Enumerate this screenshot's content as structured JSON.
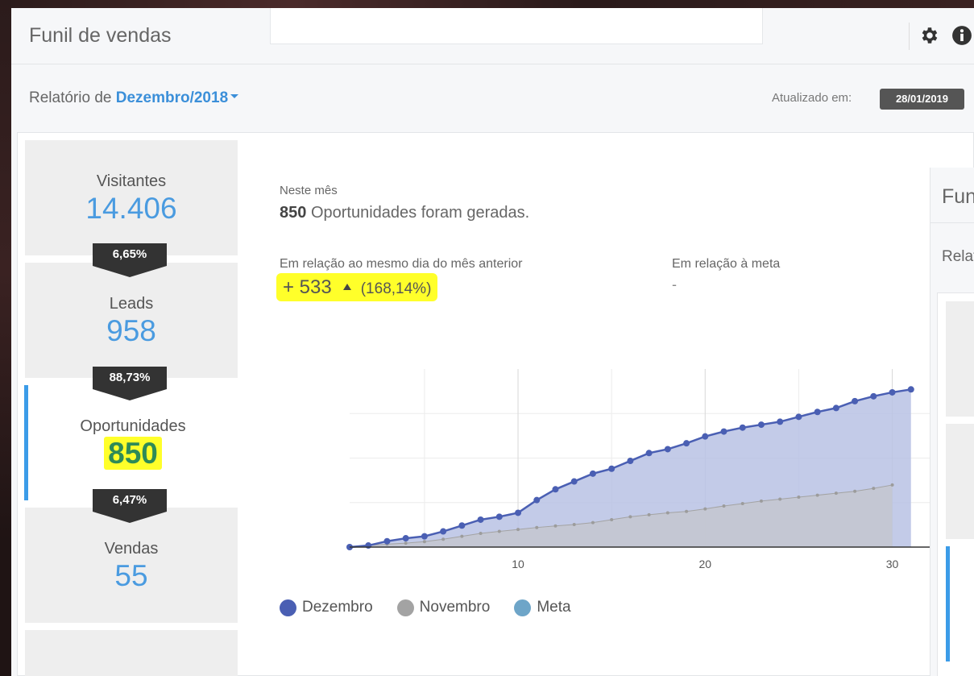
{
  "header": {
    "title": "Funil de vendas",
    "icons": [
      "gear-icon",
      "info-icon"
    ]
  },
  "report": {
    "label": "Relatório de",
    "month": "Dezembro/2018",
    "updated_label": "Atualizado em:",
    "updated_date": "28/01/2019"
  },
  "funnel": {
    "stages": [
      {
        "name": "Visitantes",
        "value": "14.406"
      },
      {
        "name": "Leads",
        "value": "958"
      },
      {
        "name": "Oportunidades",
        "value": "850"
      },
      {
        "name": "Vendas",
        "value": "55"
      }
    ],
    "conversions": [
      "6,65%",
      "88,73%",
      "6,47%"
    ]
  },
  "summary": {
    "month_label": "Neste mês",
    "count": "850",
    "text": "Oportunidades foram geradas.",
    "prev_label": "Em relação ao mesmo dia do mês anterior",
    "prev_value": "+ 533",
    "prev_pct": "(168,14%)",
    "meta_label": "Em relação à meta",
    "meta_value": "-"
  },
  "colors": {
    "accent": "#3b8fd9",
    "value_blue": "#4a9be0",
    "highlight": "#ffff2a",
    "dezembro": "#4a5fb3",
    "novembro": "#a3a3a3",
    "meta": "#6ea5c8"
  },
  "chart_data": {
    "type": "area",
    "x": [
      1,
      2,
      3,
      4,
      5,
      6,
      7,
      8,
      9,
      10,
      11,
      12,
      13,
      14,
      15,
      16,
      17,
      18,
      19,
      20,
      21,
      22,
      23,
      24,
      25,
      26,
      27,
      28,
      29,
      30,
      31
    ],
    "xlim": [
      1,
      32
    ],
    "ylim": [
      0,
      1000
    ],
    "xticks": [
      10,
      20,
      30
    ],
    "grid": true,
    "legend_position": "bottom",
    "series": [
      {
        "name": "Dezembro",
        "values": [
          0,
          8,
          30,
          45,
          55,
          80,
          110,
          140,
          155,
          175,
          240,
          295,
          335,
          375,
          400,
          440,
          480,
          500,
          530,
          565,
          590,
          610,
          625,
          640,
          665,
          690,
          710,
          745,
          770,
          790,
          805
        ]
      },
      {
        "name": "Novembro",
        "values": [
          0,
          8,
          15,
          20,
          28,
          40,
          55,
          70,
          80,
          90,
          100,
          108,
          115,
          125,
          140,
          155,
          165,
          175,
          182,
          195,
          210,
          222,
          235,
          245,
          255,
          265,
          275,
          285,
          300,
          317
        ]
      },
      {
        "name": "Meta",
        "values": []
      }
    ]
  },
  "legend": [
    "Dezembro",
    "Novembro",
    "Meta"
  ],
  "side_panel": {
    "title": "Funil de vendas",
    "subtitle": "Relatório"
  }
}
